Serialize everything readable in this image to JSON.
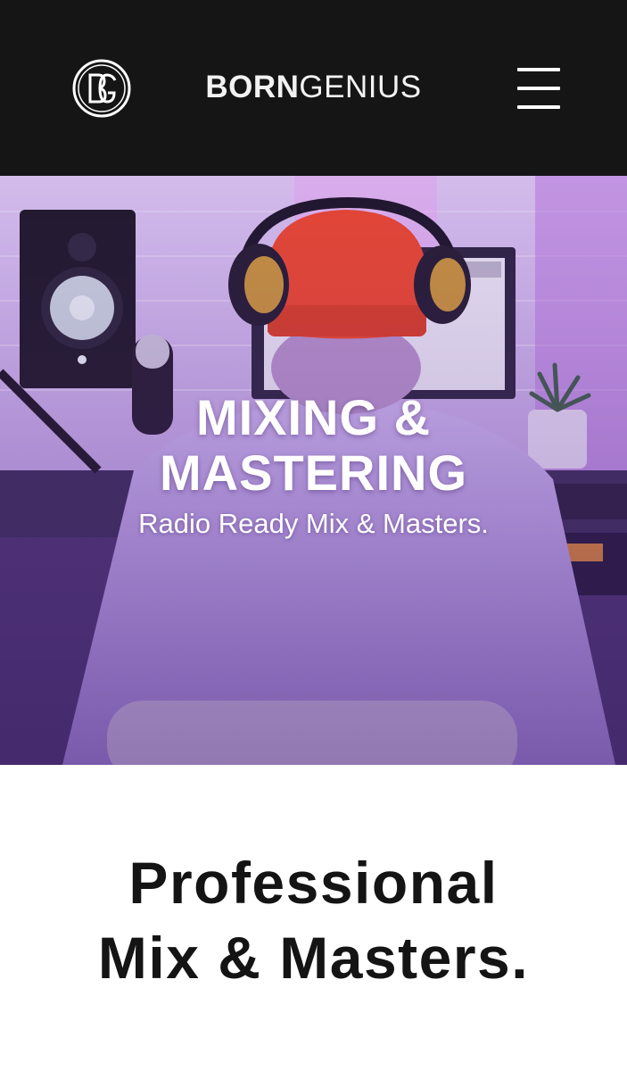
{
  "header": {
    "logo_icon": "bg-monogram-icon",
    "brand_bold": "BORN",
    "brand_light": "GENIUS",
    "menu_icon": "hamburger-menu-icon"
  },
  "hero": {
    "title": "MIXING & MASTERING",
    "subtitle": "Radio Ready Mix & Masters."
  },
  "section": {
    "title_line1": "Professional",
    "title_line2": "Mix & Masters."
  },
  "colors": {
    "header_bg": "#151515",
    "hero_tint": "#9a6fce",
    "beanie": "#e8452e",
    "text_dark": "#141414"
  }
}
